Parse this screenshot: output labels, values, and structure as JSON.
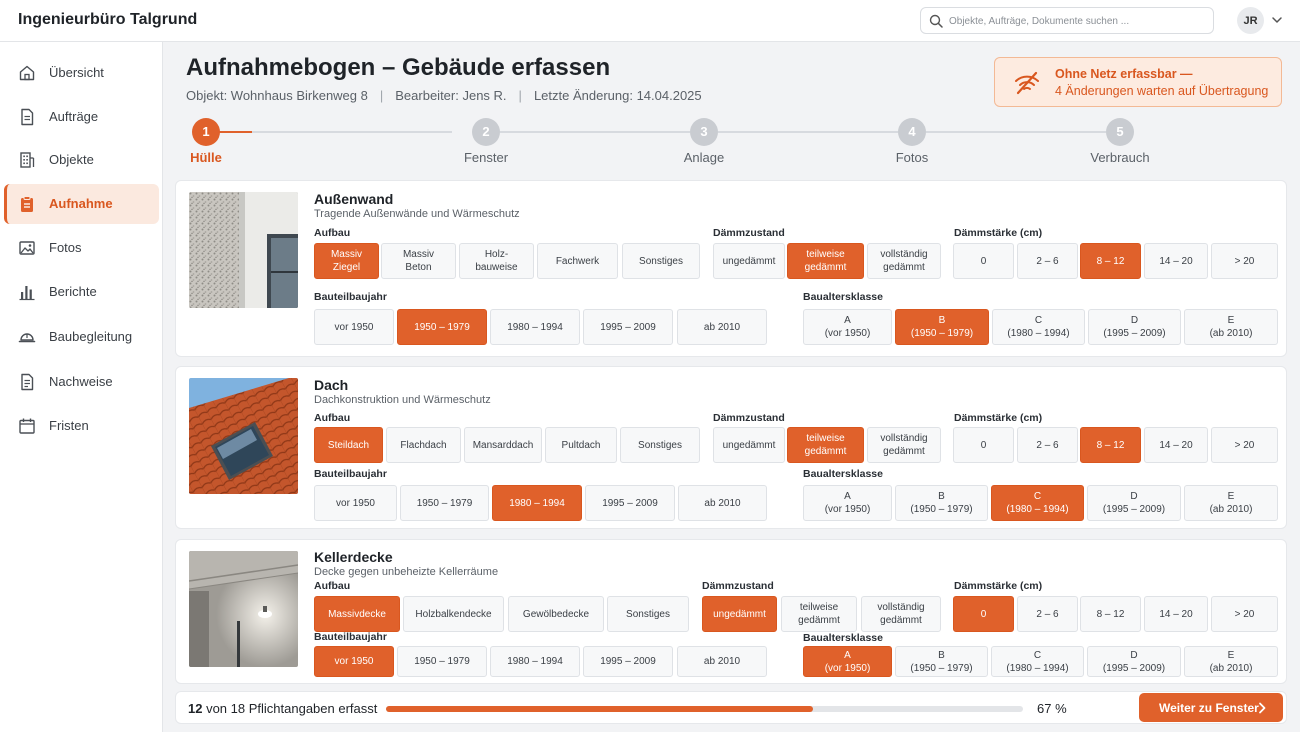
{
  "app": {
    "title": "Ingenieurbüro Talgrund"
  },
  "search": {
    "placeholder": "Objekte, Aufträge, Dokumente suchen ..."
  },
  "user": {
    "initials": "JR"
  },
  "sidebar": {
    "items": [
      {
        "label": "Übersicht",
        "icon": "home-icon",
        "active": false
      },
      {
        "label": "Aufträge",
        "icon": "document-icon",
        "active": false
      },
      {
        "label": "Objekte",
        "icon": "building-icon",
        "active": false
      },
      {
        "label": "Aufnahme",
        "icon": "clipboard-icon",
        "active": true
      },
      {
        "label": "Fotos",
        "icon": "image-icon",
        "active": false
      },
      {
        "label": "Berichte",
        "icon": "bar-chart-icon",
        "active": false
      },
      {
        "label": "Baubegleitung",
        "icon": "hardhat-icon",
        "active": false
      },
      {
        "label": "Nachweise",
        "icon": "certificate-icon",
        "active": false
      },
      {
        "label": "Fristen",
        "icon": "calendar-icon",
        "active": false
      }
    ]
  },
  "header": {
    "title": "Aufnahmebogen – Gebäude erfassen",
    "object": "Objekt: Wohnhaus Birkenweg 8",
    "editor": "Bearbeiter: Jens R.",
    "last_change": "Letzte Änderung: 14.04.2025",
    "separator": "|"
  },
  "offline": {
    "title": "Ohne Netz erfassbar —",
    "detail": "4 Änderungen warten auf Übertragung",
    "icon": "no-wifi-icon",
    "accent": "#e0612b"
  },
  "steps": [
    {
      "number": "1",
      "label": "Hülle",
      "active": true
    },
    {
      "number": "2",
      "label": "Fenster",
      "active": false
    },
    {
      "number": "3",
      "label": "Anlage",
      "active": false
    },
    {
      "number": "4",
      "label": "Fotos",
      "active": false
    },
    {
      "number": "5",
      "label": "Verbrauch",
      "active": false
    }
  ],
  "labels": {
    "aufbau": "Aufbau",
    "daemmzustand": "Dämmzustand",
    "daemmstaerke": "Dämmstärke (cm)",
    "baujahr": "Bauteilbaujahr",
    "baualtersklasse": "Baualtersklasse"
  },
  "cards": [
    {
      "title": "Außenwand",
      "subtitle": "Tragende Außenwände und Wärmeschutz",
      "aufbau": [
        "Massiv\nZiegel",
        "Massiv\nBeton",
        "Holz-\nbauweise",
        "Fachwerk",
        "Sonstiges"
      ],
      "aufbau_selected": 0,
      "daemmzustand": [
        "ungedämmt",
        "teilweise\ngedämmt",
        "vollständig\ngedämmt"
      ],
      "daemmzustand_selected": 1,
      "daemmstaerke": [
        "0",
        "2 – 6",
        "8 – 12",
        "14 – 20",
        "> 20"
      ],
      "daemmstaerke_selected": 2,
      "baujahr": [
        "vor 1950",
        "1950 – 1979",
        "1980 – 1994",
        "1995 – 2009",
        "ab 2010"
      ],
      "baujahr_selected": 1,
      "klasse": [
        "A\n(vor 1950)",
        "B\n(1950 – 1979)",
        "C\n(1980 – 1994)",
        "D\n(1995 – 2009)",
        "E\n(ab 2010)"
      ],
      "klasse_selected": 1
    },
    {
      "title": "Dach",
      "subtitle": "Dachkonstruktion und Wärmeschutz",
      "aufbau": [
        "Steildach",
        "Flachdach",
        "Mansarddach",
        "Pultdach",
        "Sonstiges"
      ],
      "aufbau_selected": 0,
      "daemmzustand": [
        "ungedämmt",
        "teilweise\ngedämmt",
        "vollständig\ngedämmt"
      ],
      "daemmzustand_selected": 1,
      "daemmstaerke": [
        "0",
        "2 – 6",
        "8 – 12",
        "14 – 20",
        "> 20"
      ],
      "daemmstaerke_selected": 2,
      "baujahr": [
        "vor 1950",
        "1950 – 1979",
        "1980 – 1994",
        "1995 – 2009",
        "ab 2010"
      ],
      "baujahr_selected": 2,
      "klasse": [
        "A\n(vor 1950)",
        "B\n(1950 – 1979)",
        "C\n(1980 – 1994)",
        "D\n(1995 – 2009)",
        "E\n(ab 2010)"
      ],
      "klasse_selected": 2
    },
    {
      "title": "Kellerdecke",
      "subtitle": "Decke gegen unbeheizte Kellerräume",
      "aufbau": [
        "Massivdecke",
        "Holzbalkendecke",
        "Gewölbedecke",
        "Sonstiges"
      ],
      "aufbau_selected": 0,
      "daemmzustand": [
        "ungedämmt",
        "teilweise\ngedämmt",
        "vollständig\ngedämmt"
      ],
      "daemmzustand_selected": 0,
      "daemmstaerke": [
        "0",
        "2 – 6",
        "8 – 12",
        "14 – 20",
        "> 20"
      ],
      "daemmstaerke_selected": 0,
      "baujahr": [
        "vor 1950",
        "1950 – 1979",
        "1980 – 1994",
        "1995 – 2009",
        "ab 2010"
      ],
      "baujahr_selected": 0,
      "klasse": [
        "A\n(vor 1950)",
        "B\n(1950 – 1979)",
        "C\n(1980 – 1994)",
        "D\n(1995 – 2009)",
        "E\n(ab 2010)"
      ],
      "klasse_selected": 0
    }
  ],
  "footer": {
    "done": "12",
    "rest": " von 18 Pflichtangaben erfasst",
    "progress": 0.67,
    "percent": "67 %",
    "next_label": "Weiter zu Fenster"
  }
}
